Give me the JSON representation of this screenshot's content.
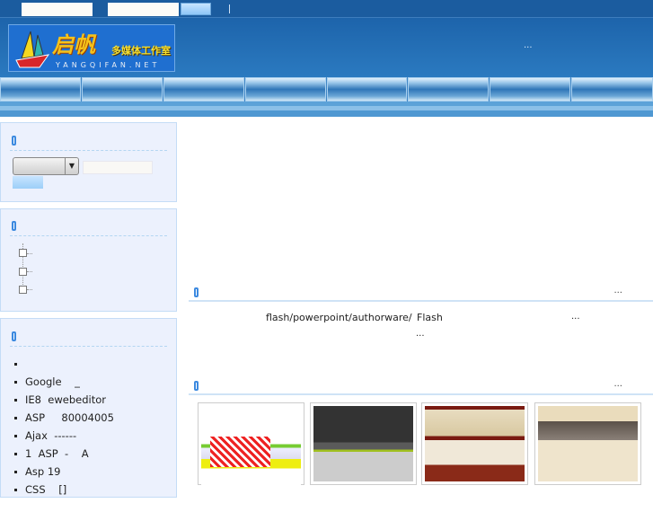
{
  "header": {
    "logo_text": "启帆",
    "logo_subtitle": "多媒体工作室",
    "logo_domain": "YANGQIFAN.NET",
    "more": "..."
  },
  "top": {
    "separator": "|"
  },
  "sidebar": {
    "news_items": [
      "",
      "Google    _",
      "IE8  ewebeditor",
      "ASP     80004005",
      "Ajax  ------",
      "1  ASP  -    A",
      "Asp 19",
      "CSS    []"
    ]
  },
  "main": {
    "intro_more": "...",
    "intro_text1": "flash/powerpoint/authorware/",
    "intro_text2": "Flash",
    "intro_dots1": "...",
    "intro_dots2": "...",
    "works_more": "...",
    "thumbnails": [
      "website-1",
      "website-2",
      "website-3",
      "website-4"
    ]
  },
  "colors": {
    "accent": "#3d8ae0",
    "top_bar": "#1b5c9f",
    "panel": "#ecf1fd"
  }
}
